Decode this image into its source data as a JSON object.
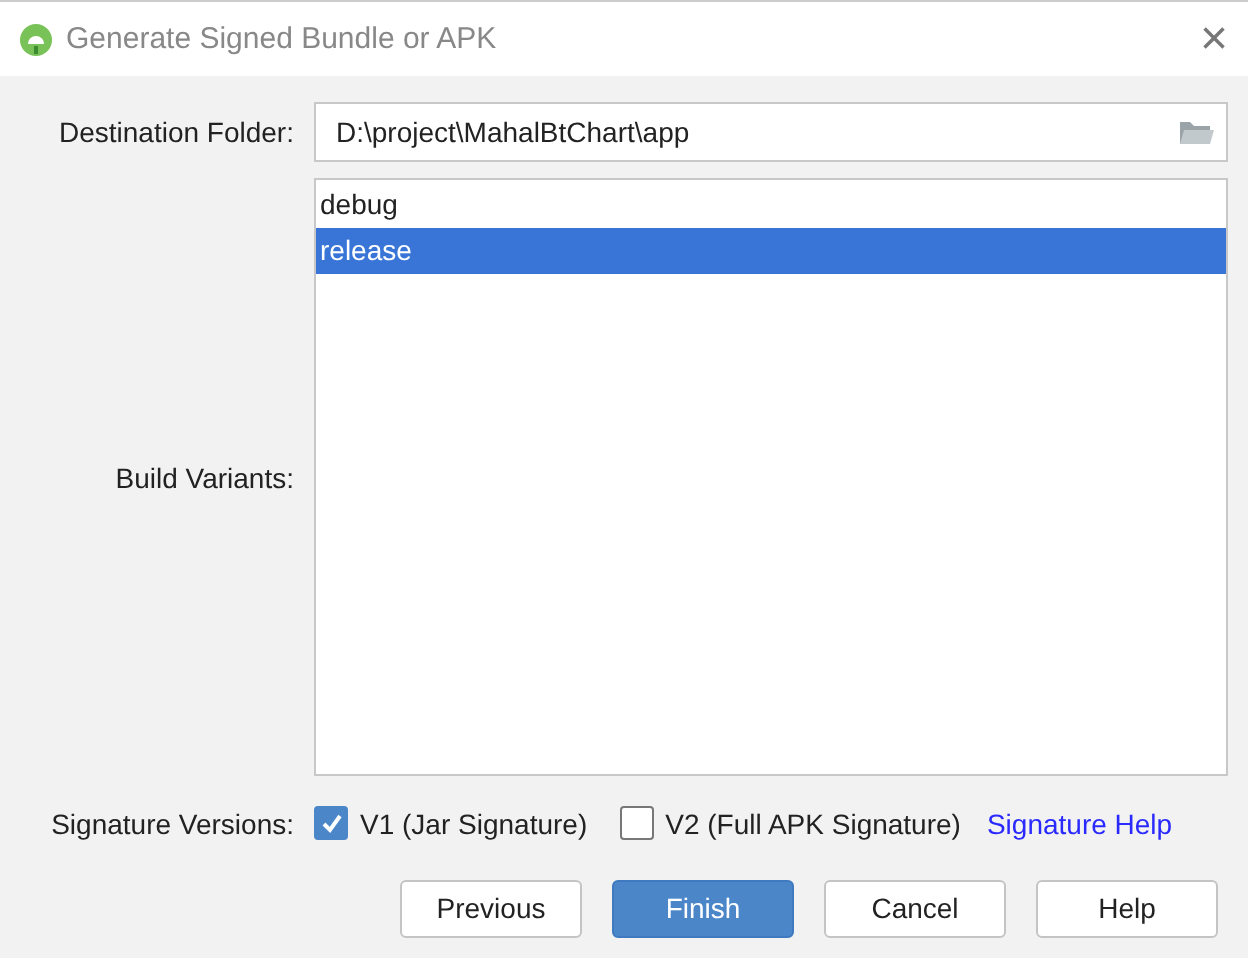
{
  "window": {
    "title": "Generate Signed Bundle or APK",
    "close": "×"
  },
  "destination": {
    "label": "Destination Folder:",
    "value": "D:\\project\\MahalBtChart\\app"
  },
  "build_variants": {
    "label": "Build Variants:",
    "items": [
      {
        "label": "debug",
        "selected": false
      },
      {
        "label": "release",
        "selected": true
      }
    ]
  },
  "signature": {
    "label": "Signature Versions:",
    "options": [
      {
        "label": "V1 (Jar Signature)",
        "checked": true
      },
      {
        "label": "V2 (Full APK Signature)",
        "checked": false
      }
    ],
    "help_link": "Signature Help"
  },
  "buttons": [
    {
      "label": "Previous",
      "primary": false
    },
    {
      "label": "Finish",
      "primary": true
    },
    {
      "label": "Cancel",
      "primary": false
    },
    {
      "label": "Help",
      "primary": false
    }
  ]
}
